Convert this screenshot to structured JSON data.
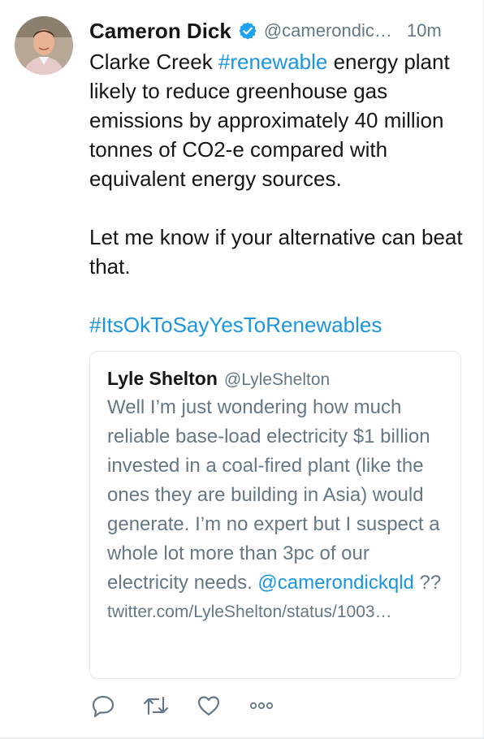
{
  "tweet": {
    "author_name": "Cameron Dick",
    "author_handle": "@camerondickqld",
    "time": "10m",
    "text_part1": "Clarke Creek ",
    "hashtag_inline": "#renewable",
    "text_part2": " energy plant likely to reduce greenhouse gas emissions by approximately 40 million tonnes of CO2-e compared with equivalent energy sources.\n\nLet me know if your alternative can beat that.\n\n",
    "hashtag_end": "#ItsOkToSayYesToRenewables"
  },
  "quoted": {
    "author_name": "Lyle Shelton",
    "author_handle": "@LyleShelton",
    "text": "Well I’m just wondering how much reliable base-load electricity $1 billion invested in a coal-fired plant (like the ones they are building in Asia) would generate. I’m no expert but I suspect a whole lot more than 3pc of our electricity needs. ",
    "mention": "@camerondickqld",
    "text_after_mention": " ??",
    "url": "twitter.com/LyleShelton/status/1003…"
  },
  "actions": {
    "reply_icon": "reply-icon",
    "retweet_icon": "retweet-icon",
    "like_icon": "heart-icon",
    "more_icon": "more-icon"
  },
  "colors": {
    "link": "#1b95e0",
    "secondary": "#657786",
    "verified": "#1da1f2"
  }
}
